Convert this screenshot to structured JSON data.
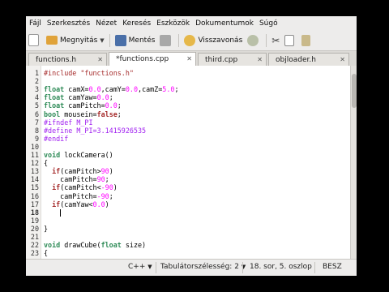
{
  "menu": [
    "Fájl",
    "Szerkesztés",
    "Nézet",
    "Keresés",
    "Eszközök",
    "Dokumentumok",
    "Súgó"
  ],
  "toolbar": {
    "new_label": "",
    "open_label": "Megnyitás",
    "save_label": "Mentés",
    "undo_label": "Visszavonás"
  },
  "tabs": [
    {
      "label": "functions.h",
      "active": false
    },
    {
      "label": "*functions.cpp",
      "active": true
    },
    {
      "label": "third.cpp",
      "active": false
    },
    {
      "label": "objloader.h",
      "active": false
    }
  ],
  "code": [
    {
      "n": "1",
      "t": [
        [
          "#include \"functions.h\"",
          "#a52a2a"
        ]
      ]
    },
    {
      "n": "2",
      "t": []
    },
    {
      "n": "3",
      "t": [
        [
          "float",
          "#2e8b57",
          "b"
        ],
        [
          " camX=",
          ""
        ],
        [
          "0.0",
          "#ff00ff"
        ],
        [
          ",camY=",
          ""
        ],
        [
          "0.0",
          "#ff00ff"
        ],
        [
          ",camZ=",
          ""
        ],
        [
          "5.0",
          "#ff00ff"
        ],
        [
          ";",
          ""
        ]
      ]
    },
    {
      "n": "4",
      "t": [
        [
          "float",
          "#2e8b57",
          "b"
        ],
        [
          " camYaw=",
          ""
        ],
        [
          "0.0",
          "#ff00ff"
        ],
        [
          ";",
          ""
        ]
      ]
    },
    {
      "n": "5",
      "t": [
        [
          "float",
          "#2e8b57",
          "b"
        ],
        [
          " camPitch=",
          ""
        ],
        [
          "0.0",
          "#ff00ff"
        ],
        [
          ";",
          ""
        ]
      ]
    },
    {
      "n": "6",
      "t": [
        [
          "bool",
          "#2e8b57",
          "b"
        ],
        [
          " mousein=",
          ""
        ],
        [
          "false",
          "#a52a2a",
          "b"
        ],
        [
          ";",
          ""
        ]
      ]
    },
    {
      "n": "7",
      "t": [
        [
          "#ifndef M_PI",
          "#a020f0"
        ]
      ]
    },
    {
      "n": "8",
      "t": [
        [
          "#define M_PI=3.1415926535",
          "#a020f0"
        ]
      ]
    },
    {
      "n": "9",
      "t": [
        [
          "#endif",
          "#a020f0"
        ]
      ]
    },
    {
      "n": "10",
      "t": []
    },
    {
      "n": "11",
      "t": [
        [
          "void",
          "#2e8b57",
          "b"
        ],
        [
          " lockCamera()",
          ""
        ]
      ]
    },
    {
      "n": "12",
      "t": [
        [
          "{",
          ""
        ]
      ]
    },
    {
      "n": "13",
      "t": [
        [
          "  ",
          ""
        ],
        [
          "if",
          "#a52a2a",
          "b"
        ],
        [
          "(camPitch>",
          ""
        ],
        [
          "90",
          "#ff00ff"
        ],
        [
          ")",
          ""
        ]
      ]
    },
    {
      "n": "14",
      "t": [
        [
          "    camPitch=",
          ""
        ],
        [
          "90",
          "#ff00ff"
        ],
        [
          ";",
          ""
        ]
      ]
    },
    {
      "n": "15",
      "t": [
        [
          "  ",
          ""
        ],
        [
          "if",
          "#a52a2a",
          "b"
        ],
        [
          "(camPitch<",
          ""
        ],
        [
          "-90",
          "#ff00ff"
        ],
        [
          ")",
          ""
        ]
      ]
    },
    {
      "n": "16",
      "t": [
        [
          "    camPitch=",
          ""
        ],
        [
          "-90",
          "#ff00ff"
        ],
        [
          ";",
          ""
        ]
      ]
    },
    {
      "n": "17",
      "t": [
        [
          "  ",
          ""
        ],
        [
          "if",
          "#a52a2a",
          "b"
        ],
        [
          "(camYaw<",
          ""
        ],
        [
          "0.0",
          "#ff00ff"
        ],
        [
          ")",
          ""
        ]
      ]
    },
    {
      "n": "18",
      "t": [],
      "current": true
    },
    {
      "n": "19",
      "t": []
    },
    {
      "n": "20",
      "t": [
        [
          "}",
          ""
        ]
      ]
    },
    {
      "n": "21",
      "t": []
    },
    {
      "n": "22",
      "t": [
        [
          "void",
          "#2e8b57",
          "b"
        ],
        [
          " drawCube(",
          ""
        ],
        [
          "float",
          "#2e8b57",
          "b"
        ],
        [
          " size)",
          ""
        ]
      ]
    },
    {
      "n": "23",
      "t": [
        [
          "{",
          ""
        ]
      ]
    }
  ],
  "status": {
    "language": "C++",
    "tab_width": "Tabulátorszélesség: 2",
    "position": "18. sor, 5. oszlop",
    "mode": "BESZ"
  },
  "colors": {
    "keyword": "#a52a2a",
    "type": "#2e8b57",
    "number": "#ff00ff",
    "preprocessor": "#a020f0",
    "string": "#a52a2a"
  }
}
